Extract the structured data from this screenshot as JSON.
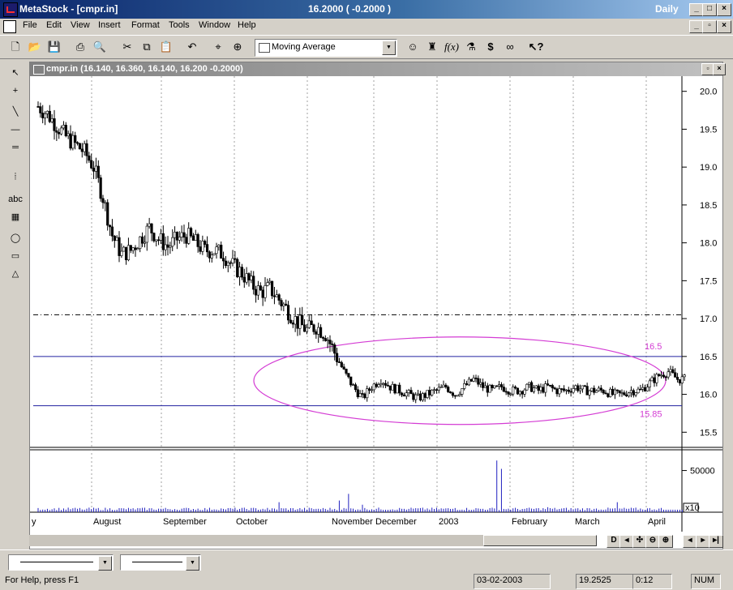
{
  "window": {
    "title": "MetaStock - [cmpr.in]",
    "quote": "16.2000 ( -0.2000 )",
    "periodicity": "Daily"
  },
  "menu": [
    "File",
    "Edit",
    "View",
    "Insert",
    "Format",
    "Tools",
    "Window",
    "Help"
  ],
  "toolbar": {
    "indicator_select": "Moving Average",
    "icons": [
      "new-icon",
      "open-icon",
      "save-icon",
      "print-icon",
      "print-preview-icon",
      "cut-icon",
      "copy-icon",
      "paste-icon",
      "undo-icon",
      "crosshair-icon",
      "zoom-icon",
      "expert-advisor-icon",
      "explorer-icon",
      "function-icon",
      "system-tester-icon",
      "dollar-icon",
      "binoculars-icon",
      "help-icon"
    ]
  },
  "left_tools": [
    "pointer-icon",
    "crosshair-icon",
    "trendline-icon",
    "horizontal-line-icon",
    "vertical-line-icon",
    "cycle-lines-icon",
    "text-icon",
    "grid-icon",
    "ellipse-icon",
    "rectangle-icon",
    "triangle-icon"
  ],
  "chart": {
    "header": "cmpr.in (16.140, 16.360, 16.140, 16.200 -0.2000)"
  },
  "chart_data": {
    "type": "candlestick",
    "security": "cmpr.in",
    "price_axis": {
      "ticks": [
        "20.0",
        "19.5",
        "19.0",
        "18.5",
        "18.0",
        "17.5",
        "17.0",
        "16.5",
        "16.0",
        "15.5"
      ],
      "range": [
        15.3,
        20.2
      ]
    },
    "x_axis": {
      "labels": [
        "y",
        "August",
        "September",
        "October",
        "November",
        "December",
        "2003",
        "February",
        "March",
        "April"
      ]
    },
    "volume_axis": {
      "ticks": [
        "50000"
      ],
      "multiplier": "x10"
    },
    "lines": [
      {
        "type": "horizontal",
        "value": 17.05,
        "style": "dash-dot"
      },
      {
        "type": "horizontal",
        "value": 16.5,
        "label": "16.5"
      },
      {
        "type": "horizontal",
        "value": 15.85,
        "label": "15.85"
      }
    ],
    "ellipse": {
      "from": "mid-October",
      "to": "end of March",
      "center_price": 16.18
    },
    "price_path": [
      [
        0,
        19.8
      ],
      [
        4,
        19.7
      ],
      [
        8,
        19.55
      ],
      [
        12,
        19.4
      ],
      [
        16,
        19.3
      ],
      [
        20,
        19.2
      ],
      [
        24,
        19.0
      ],
      [
        28,
        18.6
      ],
      [
        32,
        18.1
      ],
      [
        36,
        17.85
      ],
      [
        40,
        17.9
      ],
      [
        44,
        18.05
      ],
      [
        48,
        18.2
      ],
      [
        52,
        18.05
      ],
      [
        56,
        17.95
      ],
      [
        60,
        18.05
      ],
      [
        64,
        18.1
      ],
      [
        68,
        18.0
      ],
      [
        72,
        17.9
      ],
      [
        76,
        17.9
      ],
      [
        80,
        17.85
      ],
      [
        84,
        17.7
      ],
      [
        88,
        17.6
      ],
      [
        92,
        17.45
      ],
      [
        96,
        17.35
      ],
      [
        100,
        17.4
      ],
      [
        104,
        17.25
      ],
      [
        108,
        17.1
      ],
      [
        112,
        16.95
      ],
      [
        116,
        16.85
      ],
      [
        120,
        16.9
      ],
      [
        124,
        16.8
      ],
      [
        128,
        16.55
      ],
      [
        132,
        16.3
      ],
      [
        136,
        16.1
      ],
      [
        140,
        15.95
      ],
      [
        144,
        16.1
      ],
      [
        148,
        16.2
      ],
      [
        152,
        16.1
      ],
      [
        156,
        16.05
      ],
      [
        160,
        16.0
      ],
      [
        164,
        15.95
      ],
      [
        168,
        16.0
      ],
      [
        172,
        16.05
      ],
      [
        176,
        16.1
      ],
      [
        180,
        16.0
      ],
      [
        184,
        16.1
      ],
      [
        188,
        16.2
      ],
      [
        192,
        16.1
      ],
      [
        196,
        16.05
      ],
      [
        200,
        16.1
      ],
      [
        204,
        16.05
      ],
      [
        208,
        16.05
      ],
      [
        212,
        16.1
      ],
      [
        216,
        16.05
      ],
      [
        220,
        16.1
      ],
      [
        224,
        16.05
      ],
      [
        228,
        16.05
      ],
      [
        232,
        16.1
      ],
      [
        236,
        16.05
      ],
      [
        240,
        16.05
      ],
      [
        244,
        16.05
      ],
      [
        248,
        16.0
      ],
      [
        252,
        16.0
      ],
      [
        256,
        16.05
      ],
      [
        260,
        16.05
      ],
      [
        264,
        16.15
      ],
      [
        268,
        16.25
      ],
      [
        272,
        16.3
      ],
      [
        276,
        16.2
      ]
    ],
    "volume_path": [
      [
        0,
        5000
      ],
      [
        20,
        3000
      ],
      [
        40,
        4000
      ],
      [
        60,
        3000
      ],
      [
        80,
        4000
      ],
      [
        100,
        3000
      ],
      [
        104,
        12000
      ],
      [
        120,
        4000
      ],
      [
        130,
        14000
      ],
      [
        134,
        22000
      ],
      [
        140,
        9000
      ],
      [
        160,
        4000
      ],
      [
        180,
        5000
      ],
      [
        198,
        62000
      ],
      [
        200,
        52000
      ],
      [
        210,
        4000
      ],
      [
        220,
        6000
      ],
      [
        240,
        4000
      ],
      [
        250,
        12000
      ],
      [
        270,
        5000
      ]
    ]
  },
  "bottom": {
    "combo1": "",
    "combo2": ""
  },
  "status": {
    "help": "For Help, press F1",
    "date": "03-02-2003",
    "value": "19.2525",
    "time": "0:12",
    "num": "NUM"
  }
}
